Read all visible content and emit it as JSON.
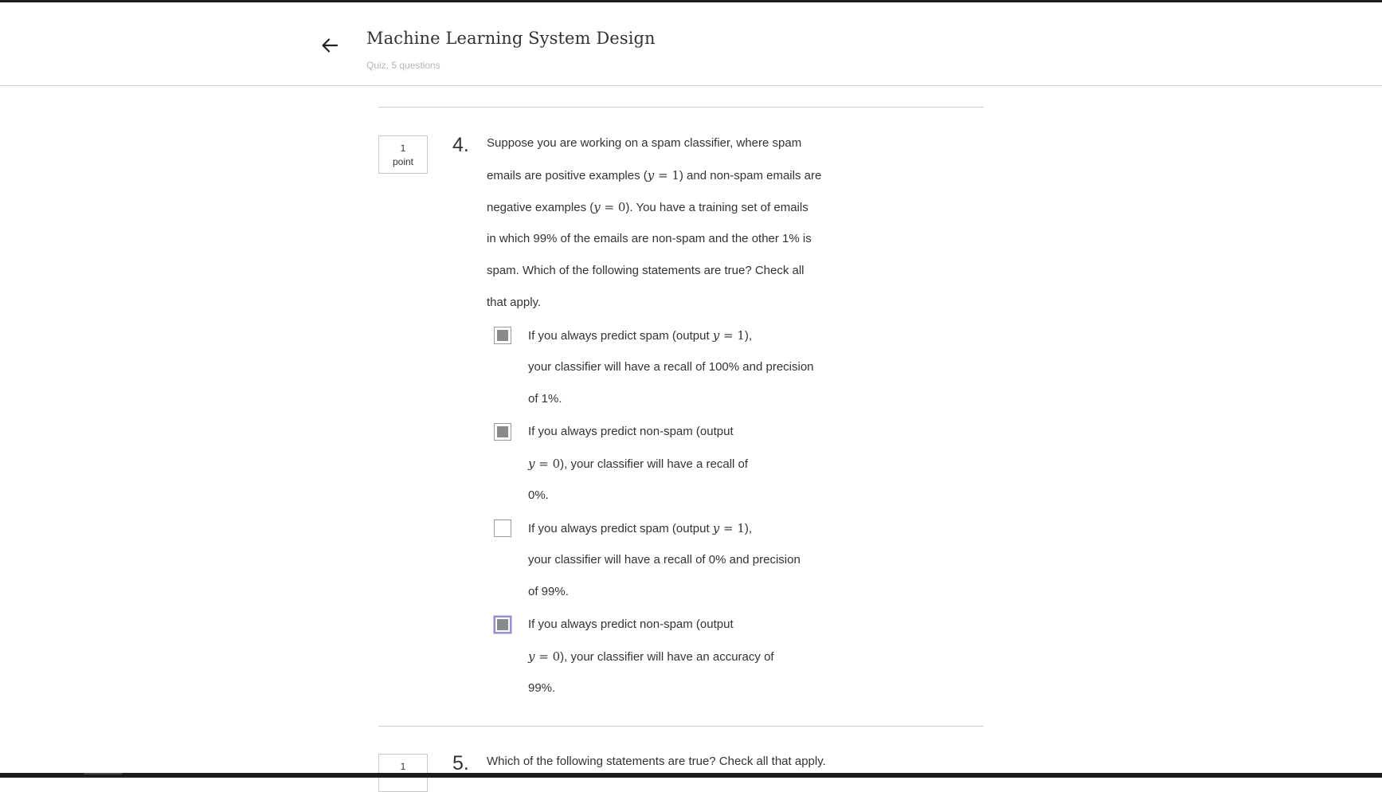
{
  "header": {
    "back_label": "",
    "title": "Machine Learning System Design",
    "subtitle": "Quiz, 5 questions"
  },
  "questions": [
    {
      "points_value": "1",
      "points_unit": "point",
      "number": "4.",
      "text_lines": [
        {
          "before": "Suppose you are working on a spam classifier, where spam",
          "math": "",
          "after": ""
        },
        {
          "before": "emails are positive examples (",
          "math": "y = 1",
          "after": ") and non-spam emails are"
        },
        {
          "before": "negative examples (",
          "math": "y = 0",
          "after": "). You have a training set of emails"
        },
        {
          "before": "in which 99% of the emails are non-spam and the other 1% is",
          "math": "",
          "after": ""
        },
        {
          "before": "spam. Which of the following statements are true? Check all",
          "math": "",
          "after": ""
        },
        {
          "before": "that apply.",
          "math": "",
          "after": ""
        }
      ],
      "options": [
        {
          "checked": true,
          "focused": false,
          "lines": [
            {
              "before": "If you always predict spam (output ",
              "math": "y = 1",
              "after": "),"
            },
            {
              "before": "your classifier will have a recall of 100% and precision",
              "math": "",
              "after": ""
            },
            {
              "before": "of 1%.",
              "math": "",
              "after": ""
            }
          ]
        },
        {
          "checked": true,
          "focused": false,
          "lines": [
            {
              "before": "If you always predict non-spam (output",
              "math": "",
              "after": ""
            },
            {
              "before": "",
              "math": "y = 0",
              "after": "), your classifier will have a recall of"
            },
            {
              "before": "0%.",
              "math": "",
              "after": ""
            }
          ]
        },
        {
          "checked": false,
          "focused": false,
          "lines": [
            {
              "before": "If you always predict spam (output ",
              "math": "y = 1",
              "after": "),"
            },
            {
              "before": "your classifier will have a recall of 0% and precision",
              "math": "",
              "after": ""
            },
            {
              "before": "of 99%.",
              "math": "",
              "after": ""
            }
          ]
        },
        {
          "checked": true,
          "focused": true,
          "lines": [
            {
              "before": "If you always predict non-spam (output",
              "math": "",
              "after": ""
            },
            {
              "before": "",
              "math": "y = 0",
              "after": "), your classifier will have an accuracy of"
            },
            {
              "before": "99%.",
              "math": "",
              "after": ""
            }
          ]
        }
      ]
    },
    {
      "points_value": "1",
      "points_unit": "",
      "number": "5.",
      "text_lines": [
        {
          "before": "Which of the following statements are true? Check all that apply.",
          "math": "",
          "after": ""
        }
      ],
      "options": []
    }
  ],
  "colors": {
    "text": "#333333",
    "muted": "#b4b4b4",
    "rule": "#cfcfcf",
    "checkbox_fill": "#8a8a8a",
    "focus_ring": "#8d8fe0"
  }
}
